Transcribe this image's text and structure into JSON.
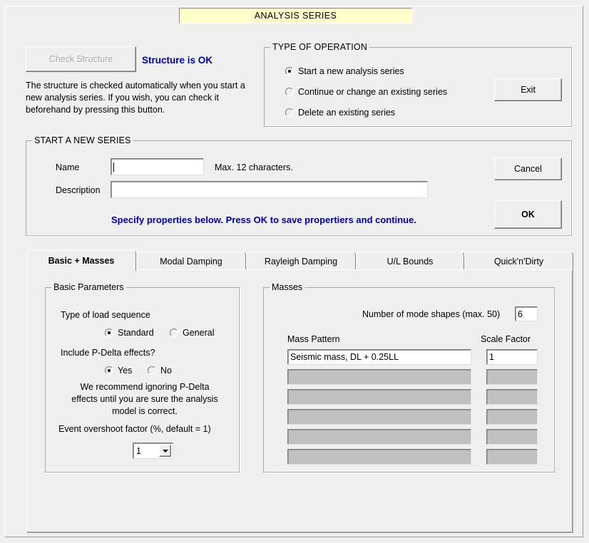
{
  "window": {
    "banner_title": "ANALYSIS SERIES"
  },
  "check": {
    "button_label": "Check Structure",
    "status_text": "Structure is OK",
    "help_text": "The structure is checked automatically when you start a new analysis series. If you wish, you can check it beforehand by pressing this button."
  },
  "type_of_operation": {
    "legend": "TYPE OF OPERATION",
    "options": [
      {
        "label": "Start a new analysis series",
        "selected": true
      },
      {
        "label": "Continue or change an existing series",
        "selected": false
      },
      {
        "label": "Delete an existing series",
        "selected": false
      }
    ],
    "exit_label": "Exit"
  },
  "new_series": {
    "legend": "START A NEW SERIES",
    "name_label": "Name",
    "name_value": "",
    "name_hint": "Max. 12 characters.",
    "description_label": "Description",
    "description_value": "",
    "instruction": "Specify properties below. Press OK to save propertiers and continue.",
    "cancel_label": "Cancel",
    "ok_label": "OK"
  },
  "tabs": [
    {
      "label": "Basic + Masses",
      "active": true
    },
    {
      "label": "Modal  Damping",
      "active": false
    },
    {
      "label": "Rayleigh Damping",
      "active": false
    },
    {
      "label": "U/L Bounds",
      "active": false
    },
    {
      "label": "Quick'n'Dirty",
      "active": false
    }
  ],
  "basic_parameters": {
    "legend": "Basic Parameters",
    "load_sequence_label": "Type of load sequence",
    "load_sequence_options": [
      {
        "label": "Standard",
        "selected": true
      },
      {
        "label": "General",
        "selected": false
      }
    ],
    "pdelta_label": "Include P-Delta effects?",
    "pdelta_options": [
      {
        "label": "Yes",
        "selected": true
      },
      {
        "label": "No",
        "selected": false
      }
    ],
    "pdelta_note": "We recommend ignoring P-Delta effects until you are sure the analysis model is correct.",
    "overshoot_label": "Event overshoot factor (%, default = 1)",
    "overshoot_value": "1"
  },
  "masses": {
    "legend": "Masses",
    "mode_shapes_label": "Number of mode shapes (max. 50)",
    "mode_shapes_value": "6",
    "mass_pattern_header": "Mass Pattern",
    "scale_factor_header": "Scale Factor",
    "rows": [
      {
        "pattern": "Seismic mass, DL + 0.25LL",
        "scale": "1",
        "enabled": true
      },
      {
        "pattern": "",
        "scale": "",
        "enabled": false
      },
      {
        "pattern": "",
        "scale": "",
        "enabled": false
      },
      {
        "pattern": "",
        "scale": "",
        "enabled": false
      },
      {
        "pattern": "",
        "scale": "",
        "enabled": false
      },
      {
        "pattern": "",
        "scale": "",
        "enabled": false
      }
    ]
  },
  "colors": {
    "banner_bg": "#ffffcc",
    "accent_blue": "#0000aa",
    "face": "#efefef",
    "disabled_field": "#c0c0c0"
  }
}
